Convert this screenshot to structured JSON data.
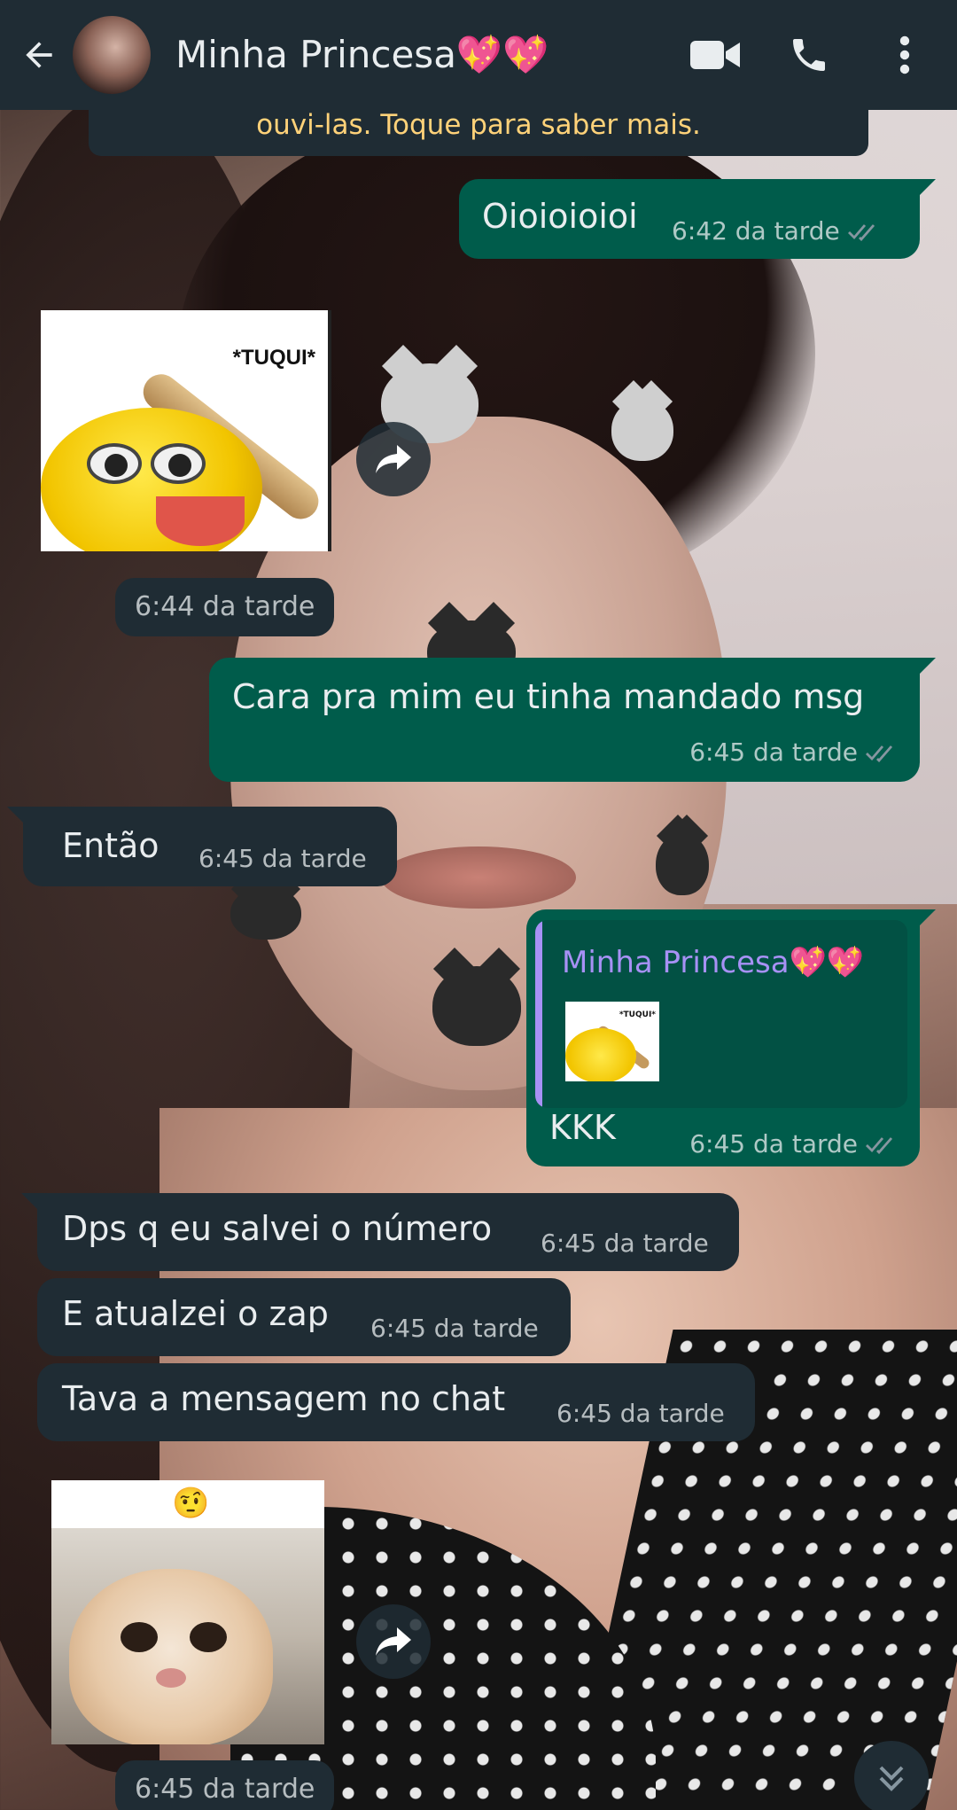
{
  "header": {
    "contact_name": "Minha Princesa💖💖",
    "icons": [
      "back-arrow-icon",
      "video-call-icon",
      "voice-call-icon",
      "more-options-icon"
    ]
  },
  "banner": {
    "text": "ouvi-las. Toque para saber mais."
  },
  "messages": [
    {
      "dir": "out",
      "text": "Oioioioioi",
      "time": "6:42 da tarde",
      "status": "read"
    },
    {
      "dir": "in",
      "type": "sticker",
      "caption": "*TUQUI*",
      "time": "6:44 da tarde"
    },
    {
      "dir": "out",
      "text": "Cara pra mim eu tinha mandado msg",
      "time": "6:45 da tarde",
      "status": "read"
    },
    {
      "dir": "in",
      "text": "Então",
      "time": "6:45 da tarde"
    },
    {
      "dir": "out",
      "reply_to": "Minha Princesa💖💖",
      "reply_caption": "*TUQUI*",
      "text": "KKK",
      "time": "6:45 da tarde",
      "status": "read"
    },
    {
      "dir": "in",
      "text": "Dps q eu salvei o número",
      "time": "6:45 da tarde"
    },
    {
      "dir": "in",
      "text": "E atualzei o zap",
      "time": "6:45 da tarde"
    },
    {
      "dir": "in",
      "text": "Tava a mensagem no chat",
      "time": "6:45 da tarde"
    },
    {
      "dir": "in",
      "type": "sticker",
      "emoji": "🤨",
      "time": "6:45 da tarde"
    }
  ],
  "colors": {
    "header_bg": "#1f2c34",
    "outgoing_bubble": "#005c4b",
    "incoming_bubble": "#1f2c34",
    "banner_text": "#ffd279",
    "reply_accent": "#a791f5",
    "read_ticks": "#8696a0"
  }
}
